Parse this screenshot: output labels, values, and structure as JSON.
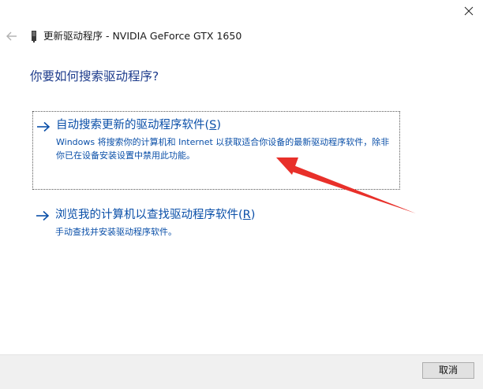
{
  "window": {
    "header_title": "更新驱动程序 - NVIDIA GeForce GTX 1650",
    "question": "你要如何搜索驱动程序?"
  },
  "options": [
    {
      "title_prefix": "自动搜索更新的驱动程序软件(",
      "accelerator": "S",
      "title_suffix": ")",
      "description": "Windows 将搜索你的计算机和 Internet 以获取适合你设备的最新驱动程序软件，除非你已在设备安装设置中禁用此功能。"
    },
    {
      "title_prefix": "浏览我的计算机以查找驱动程序软件(",
      "accelerator": "R",
      "title_suffix": ")",
      "description": "手动查找并安装驱动程序软件。"
    }
  ],
  "footer": {
    "cancel_label": "取消"
  },
  "icons": {
    "close": "close-icon",
    "back": "back-arrow-icon",
    "device": "device-icon",
    "option_arrow": "arrow-right-icon"
  },
  "colors": {
    "link": "#0a4fa8",
    "heading": "#1e3c8c",
    "annotation": "#e8302a",
    "footer_bg": "#f0f0f0"
  }
}
